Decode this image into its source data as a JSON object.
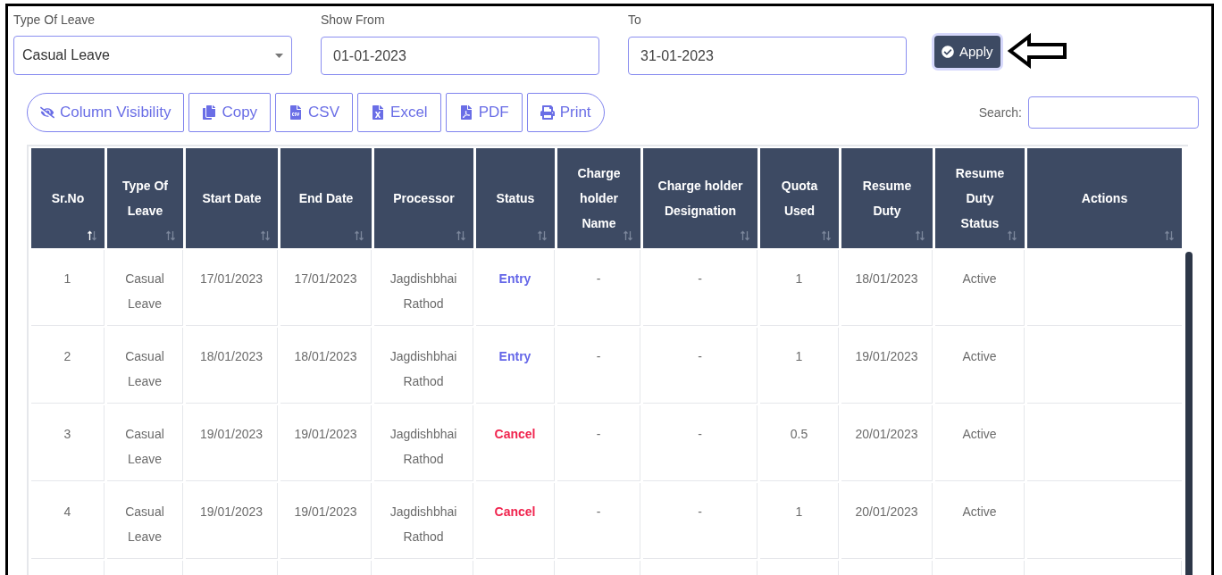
{
  "filters": {
    "type_of_leave": {
      "label": "Type Of Leave",
      "value": "Casual Leave"
    },
    "show_from": {
      "label": "Show From",
      "value": "01-01-2023"
    },
    "to": {
      "label": "To",
      "value": "31-01-2023"
    },
    "apply_button": "Apply"
  },
  "export_buttons": [
    {
      "label": "Column Visibility",
      "kind": "visibility"
    },
    {
      "label": "Copy",
      "kind": "copy"
    },
    {
      "label": "CSV",
      "kind": "csv"
    },
    {
      "label": "Excel",
      "kind": "excel"
    },
    {
      "label": "PDF",
      "kind": "pdf"
    },
    {
      "label": "Print",
      "kind": "print"
    }
  ],
  "search": {
    "label": "Search:"
  },
  "table": {
    "columns": [
      {
        "label": "Sr.No",
        "sorted": true
      },
      {
        "label": "Type Of Leave",
        "sorted": false
      },
      {
        "label": "Start Date",
        "sorted": false
      },
      {
        "label": "End Date",
        "sorted": false
      },
      {
        "label": "Processor",
        "sorted": false
      },
      {
        "label": "Status",
        "sorted": false
      },
      {
        "label": "Charge holder Name",
        "sorted": false
      },
      {
        "label": "Charge holder Designation",
        "sorted": false
      },
      {
        "label": "Quota Used",
        "sorted": false
      },
      {
        "label": "Resume Duty",
        "sorted": false
      },
      {
        "label": "Resume Duty Status",
        "sorted": false
      },
      {
        "label": "Actions",
        "sorted": false
      }
    ],
    "rows": [
      {
        "sr_no": "1",
        "type": "Casual Leave",
        "start": "17/01/2023",
        "end": "17/01/2023",
        "processor": "Jagdishbhai Rathod",
        "status": {
          "text": "Entry",
          "kind": "entry"
        },
        "charge_name": "-",
        "charge_designation": "-",
        "quota": "1",
        "resume_duty": "18/01/2023",
        "resume_status": "Active"
      },
      {
        "sr_no": "2",
        "type": "Casual Leave",
        "start": "18/01/2023",
        "end": "18/01/2023",
        "processor": "Jagdishbhai Rathod",
        "status": {
          "text": "Entry",
          "kind": "entry"
        },
        "charge_name": "-",
        "charge_designation": "-",
        "quota": "1",
        "resume_duty": "19/01/2023",
        "resume_status": "Active"
      },
      {
        "sr_no": "3",
        "type": "Casual Leave",
        "start": "19/01/2023",
        "end": "19/01/2023",
        "processor": "Jagdishbhai Rathod",
        "status": {
          "text": "Cancel",
          "kind": "cancel"
        },
        "charge_name": "-",
        "charge_designation": "-",
        "quota": "0.5",
        "resume_duty": "20/01/2023",
        "resume_status": "Active"
      },
      {
        "sr_no": "4",
        "type": "Casual Leave",
        "start": "19/01/2023",
        "end": "19/01/2023",
        "processor": "Jagdishbhai Rathod",
        "status": {
          "text": "Cancel",
          "kind": "cancel"
        },
        "charge_name": "-",
        "charge_designation": "-",
        "quota": "1",
        "resume_duty": "20/01/2023",
        "resume_status": "Active"
      }
    ]
  }
}
